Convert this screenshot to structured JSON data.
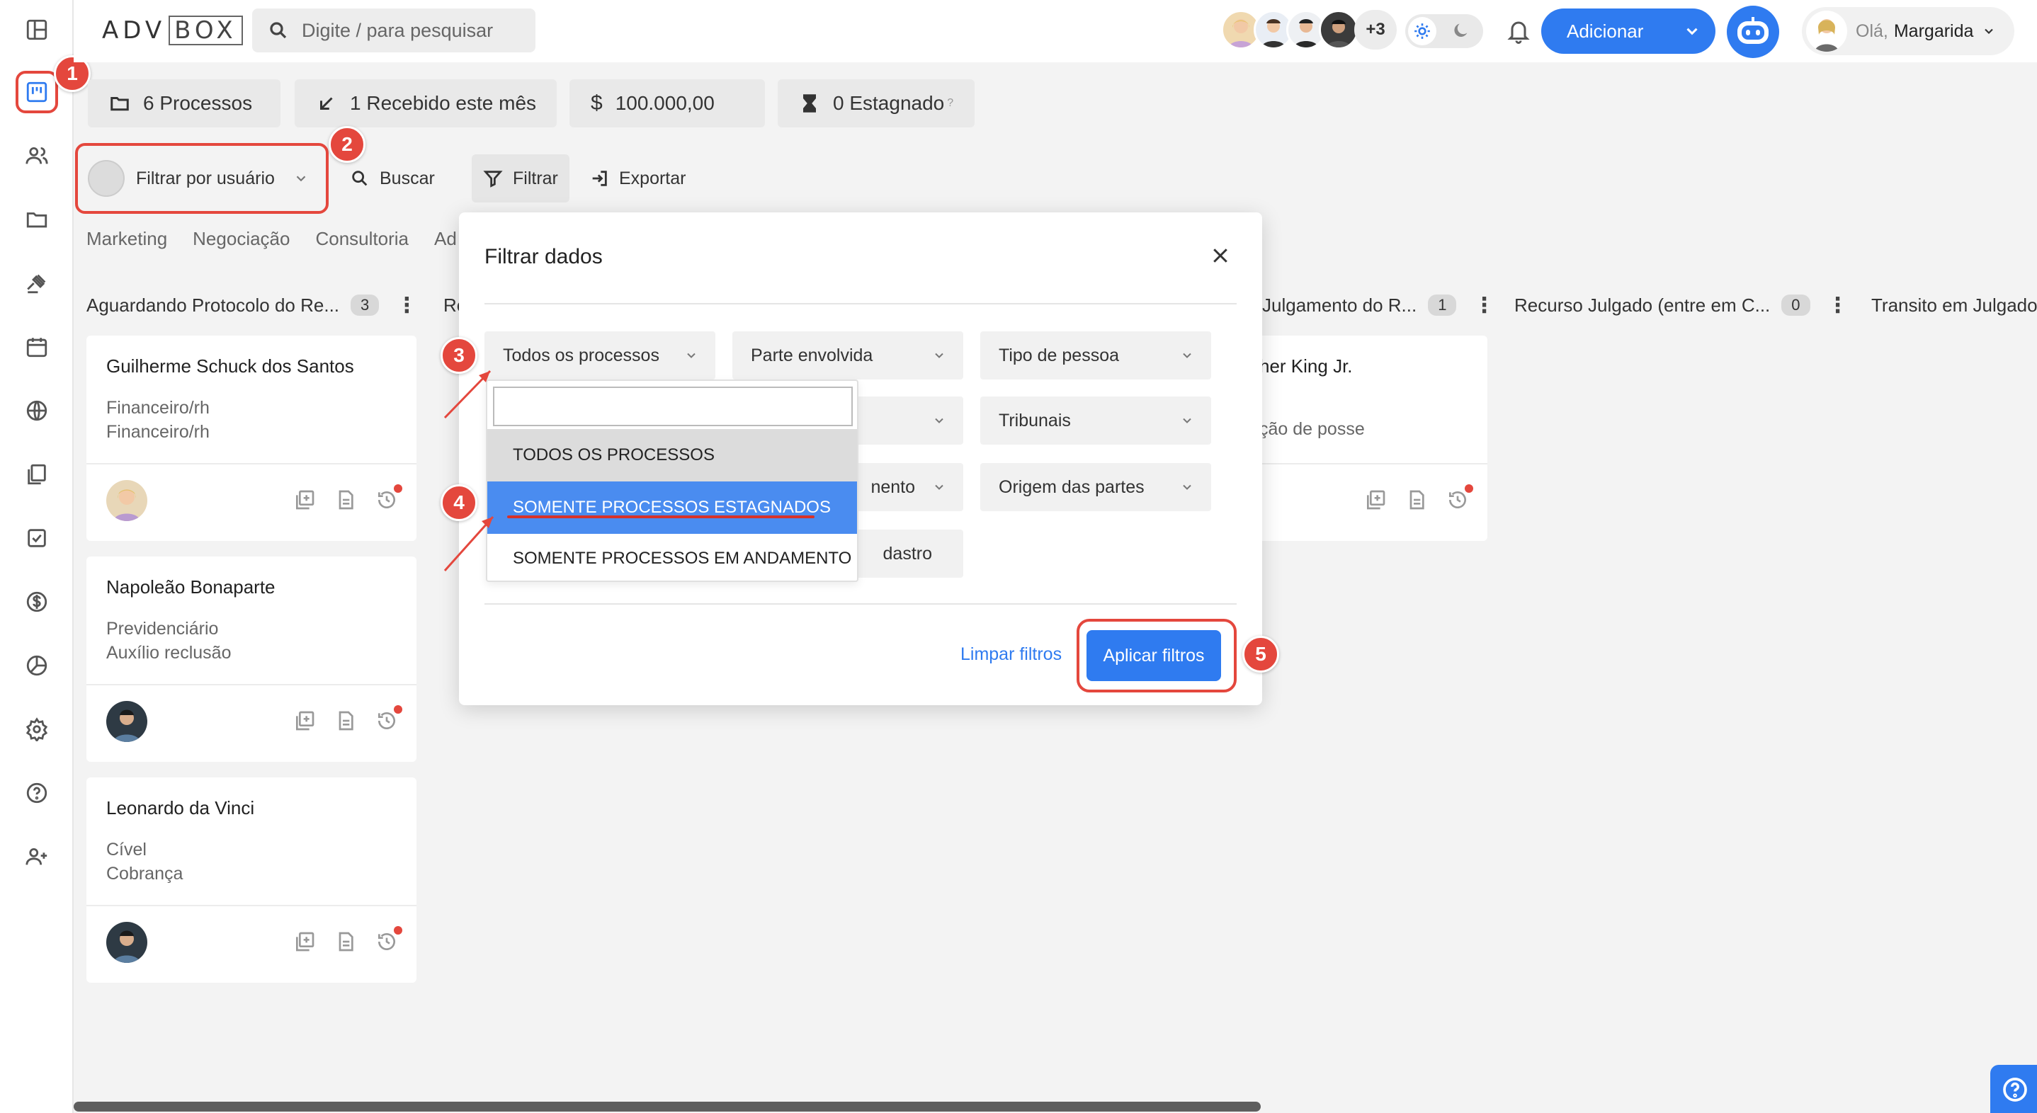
{
  "app": {
    "logo_left": "ADV",
    "logo_right": "BOX"
  },
  "header": {
    "search_placeholder": "Digite / para pesquisar",
    "avatars_more": "+3",
    "add_label": "Adicionar",
    "greeting": "Olá,",
    "user_name": "Margarida"
  },
  "stats": {
    "processos": "6 Processos",
    "recebido": "1 Recebido este mês",
    "valor": "100.000,00",
    "currency_symbol": "$",
    "estagnado": "0 Estagnado",
    "estagnado_help": "?"
  },
  "toolbar": {
    "user_filter": "Filtrar por usuário",
    "buscar": "Buscar",
    "filtrar": "Filtrar",
    "exportar": "Exportar"
  },
  "tabs": [
    "Marketing",
    "Negociação",
    "Consultoria",
    "Ad"
  ],
  "board": {
    "columns": [
      {
        "title": "Aguardando Protocolo do Re...",
        "count": "3"
      },
      {
        "title": "Re",
        "count": ""
      },
      {
        "title": "Julgamento do R...",
        "count": "1"
      },
      {
        "title": "Recurso Julgado (entre em C...",
        "count": "0"
      },
      {
        "title": "Transito em Julgado",
        "count": ""
      }
    ],
    "cards": [
      {
        "title": "Guilherme Schuck dos Santos",
        "line1": "Financeiro/rh",
        "line2": "Financeiro/rh"
      },
      {
        "title": "Napoleão Bonaparte",
        "line1": "Previdenciário",
        "line2": "Auxílio reclusão"
      },
      {
        "title": "Leonardo da Vinci",
        "line1": "Cível",
        "line2": "Cobrança"
      }
    ],
    "partial_card": {
      "title": "her King Jr.",
      "line1": "ção de posse"
    }
  },
  "modal": {
    "title": "Filtrar dados",
    "selects": {
      "processos": "Todos os processos",
      "parte": "Parte envolvida",
      "tipo_pessoa": "Tipo de pessoa",
      "tribunais": "Tribunais",
      "andamento_partial": "nento",
      "origem": "Origem das partes",
      "cadastro_partial": "dastro"
    },
    "clear": "Limpar filtros",
    "apply": "Aplicar filtros"
  },
  "dropdown": {
    "search_value": "",
    "options": [
      "TODOS OS PROCESSOS",
      "SOMENTE PROCESSOS ESTAGNADOS",
      "SOMENTE PROCESSOS EM ANDAMENTO"
    ],
    "selected_index": 1
  },
  "annotations": [
    "1",
    "2",
    "3",
    "4",
    "5"
  ],
  "colors": {
    "accent": "#2f7bf0",
    "annotation": "#e4473d",
    "selected": "#4a8cf0"
  }
}
